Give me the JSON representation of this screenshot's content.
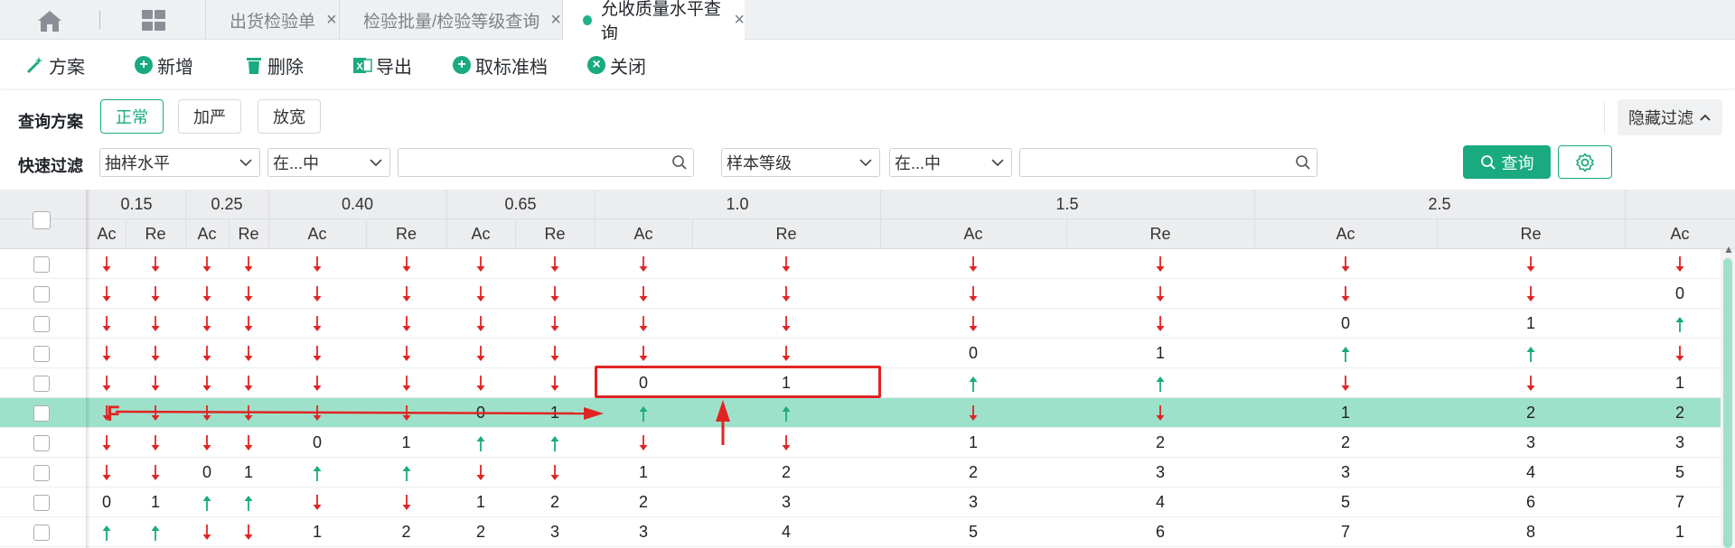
{
  "tabbar": {
    "tabs": [
      {
        "label": "出货检验单",
        "close": "×"
      },
      {
        "label": "检验批量/检验等级查询",
        "close": "×"
      },
      {
        "label": "允收质量水平查询",
        "close": "×"
      }
    ]
  },
  "toolbar": {
    "scheme": "方案",
    "add": "新增",
    "delete": "删除",
    "export": "导出",
    "unstandard": "取标准档",
    "close": "关闭"
  },
  "filter": {
    "scheme_label": "查询方案",
    "plans": [
      "正常",
      "加严",
      "放宽"
    ],
    "hide_filter": "隐藏过滤",
    "quick_label": "快速过滤",
    "field1": "抽样水平",
    "op1": "在...中",
    "value1": "",
    "field2": "样本等级",
    "op2": "在...中",
    "value2": "",
    "query": "查询"
  },
  "table": {
    "groups": [
      "0.15",
      "0.25",
      "0.40",
      "0.65",
      "1.0",
      "1.5",
      "2.5",
      ""
    ],
    "sub": [
      "Ac",
      "Re",
      "Ac",
      "Re",
      "Ac",
      "Re",
      "Ac",
      "Re",
      "Ac",
      "Re",
      "Ac",
      "Re",
      "Ac",
      "Re",
      "Ac"
    ],
    "rows": [
      [
        "d",
        "d",
        "d",
        "d",
        "d",
        "d",
        "d",
        "d",
        "d",
        "d",
        "d",
        "d",
        "d",
        "d",
        "d"
      ],
      [
        "d",
        "d",
        "d",
        "d",
        "d",
        "d",
        "d",
        "d",
        "d",
        "d",
        "d",
        "d",
        "d",
        "d",
        "0"
      ],
      [
        "d",
        "d",
        "d",
        "d",
        "d",
        "d",
        "d",
        "d",
        "d",
        "d",
        "d",
        "d",
        "0",
        "1",
        "u"
      ],
      [
        "d",
        "d",
        "d",
        "d",
        "d",
        "d",
        "d",
        "d",
        "d",
        "d",
        "0",
        "1",
        "u",
        "u",
        "d"
      ],
      [
        "d",
        "d",
        "d",
        "d",
        "d",
        "d",
        "d",
        "d",
        "0",
        "1",
        "u",
        "u",
        "d",
        "d",
        "1"
      ],
      [
        "d",
        "d",
        "d",
        "d",
        "d",
        "d",
        "0",
        "1",
        "u",
        "u",
        "d",
        "d",
        "1",
        "2",
        "2"
      ],
      [
        "d",
        "d",
        "d",
        "d",
        "0",
        "1",
        "u",
        "u",
        "d",
        "d",
        "1",
        "2",
        "2",
        "3",
        "3"
      ],
      [
        "d",
        "d",
        "0",
        "1",
        "u",
        "u",
        "d",
        "d",
        "1",
        "2",
        "2",
        "3",
        "3",
        "4",
        "5"
      ],
      [
        "0",
        "1",
        "u",
        "u",
        "d",
        "d",
        "1",
        "2",
        "2",
        "3",
        "3",
        "4",
        "5",
        "6",
        "7"
      ],
      [
        "u",
        "u",
        "d",
        "d",
        "1",
        "2",
        "2",
        "3",
        "3",
        "4",
        "5",
        "6",
        "7",
        "8",
        "1"
      ]
    ],
    "highlight_row": 5,
    "annotation_label": "F"
  },
  "colors": {
    "accent": "#1aaa80",
    "highlight": "#9ee1cb",
    "down": "#e02424",
    "up": "#1aaa80"
  }
}
